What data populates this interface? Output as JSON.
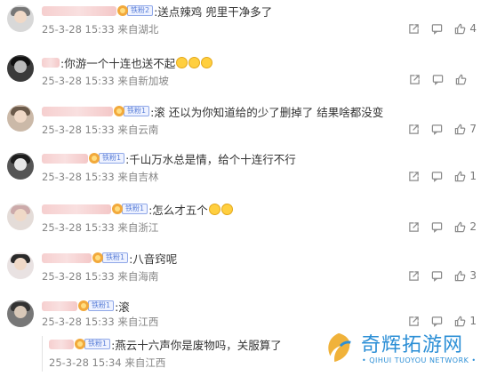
{
  "comments": [
    {
      "text": ":送点辣鸡 兜里干净多了",
      "emojis": 0,
      "badge": "铁粉2",
      "meta": "25-3-28 15:33 来自湖北",
      "likes": "4"
    },
    {
      "text": ":你游一个十连也送不起",
      "emojis": 3,
      "badge": "",
      "meta": "25-3-28 15:33 来自新加坡",
      "likes": ""
    },
    {
      "text": ":滚 还以为你知道给的少了删掉了 结果啥都没变",
      "emojis": 0,
      "badge": "铁粉1",
      "meta": "25-3-28 15:33 来自云南",
      "likes": "7"
    },
    {
      "text": ":千山万水总是情，给个十连行不行",
      "emojis": 0,
      "badge": "铁粉1",
      "meta": "25-3-28 15:33 来自吉林",
      "likes": "1"
    },
    {
      "text": ":怎么才五个",
      "emojis": 2,
      "badge": "铁粉1",
      "meta": "25-3-28 15:33 来自浙江",
      "likes": "2"
    },
    {
      "text": ":八音窍呢",
      "emojis": 0,
      "badge": "铁粉1",
      "meta": "25-3-28 15:33 来自海南",
      "likes": "3"
    },
    {
      "text": ":滚",
      "emojis": 0,
      "badge": "铁粉1",
      "meta": "25-3-28 15:33 来自江西",
      "likes": "1"
    }
  ],
  "reply": {
    "text": ":燕云十六声你是废物吗，关服算了",
    "badge": "铁粉1",
    "meta": "25-3-28 15:34 来自江西"
  },
  "watermark": {
    "cn": "奇辉拓游网",
    "en": "• QIHUI TUOYOU NETWORK •"
  },
  "colors": {
    "badge_tag": "#5a7fd8",
    "meta": "#868686",
    "text": "#333333",
    "watermark": "#2c8fd6"
  }
}
